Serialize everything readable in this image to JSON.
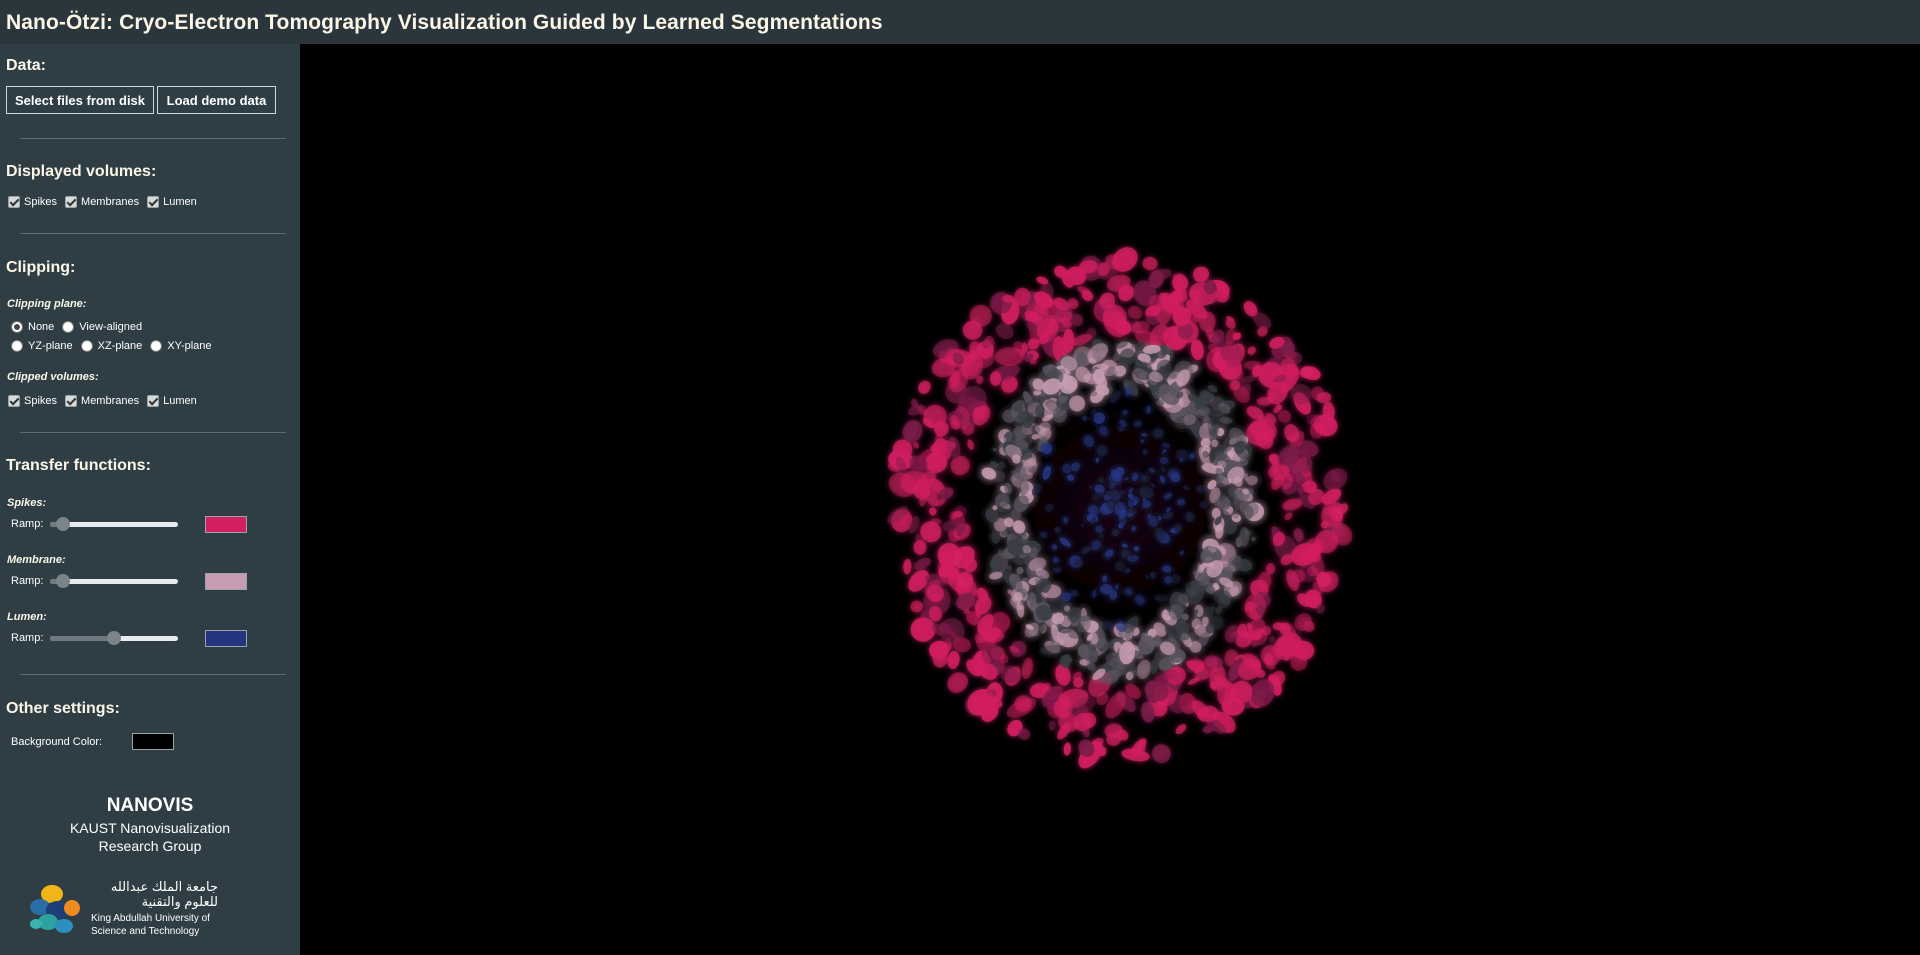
{
  "header": {
    "title": "Nano-Ötzi: Cryo-Electron Tomography Visualization Guided by Learned Segmentations"
  },
  "data_section": {
    "title": "Data:",
    "select_files_label": "Select files from disk",
    "load_demo_label": "Load demo data"
  },
  "displayed_volumes": {
    "title": "Displayed volumes:",
    "items": [
      {
        "label": "Spikes",
        "checked": true
      },
      {
        "label": "Membranes",
        "checked": true
      },
      {
        "label": "Lumen",
        "checked": true
      }
    ]
  },
  "clipping": {
    "title": "Clipping:",
    "plane_title": "Clipping plane:",
    "planes": [
      {
        "label": "None",
        "selected": true
      },
      {
        "label": "View-aligned",
        "selected": false
      },
      {
        "label": "YZ-plane",
        "selected": false
      },
      {
        "label": "XZ-plane",
        "selected": false
      },
      {
        "label": "XY-plane",
        "selected": false
      }
    ],
    "clipped_title": "Clipped volumes:",
    "clipped": [
      {
        "label": "Spikes",
        "checked": true
      },
      {
        "label": "Membranes",
        "checked": true
      },
      {
        "label": "Lumen",
        "checked": true
      }
    ]
  },
  "transfer_functions": {
    "title": "Transfer functions:",
    "items": [
      {
        "name": "Spikes:",
        "ramp_label": "Ramp:",
        "ramp_value": 0.1,
        "color": "#d21f60"
      },
      {
        "name": "Membrane:",
        "ramp_label": "Ramp:",
        "ramp_value": 0.1,
        "color": "#c79cb2"
      },
      {
        "name": "Lumen:",
        "ramp_label": "Ramp:",
        "ramp_value": 0.5,
        "color": "#243580"
      }
    ]
  },
  "other_settings": {
    "title": "Other settings:",
    "bg_label": "Background Color:",
    "bg_color": "#000000"
  },
  "footer": {
    "group_name": "NANOVIS",
    "group_desc_line1": "KAUST Nanovisualization",
    "group_desc_line2": "Research Group",
    "kaust_ar_line1": "جامعة الملك عبدالله",
    "kaust_ar_line2": "للعلوم والتقنية",
    "kaust_en_line1": "King Abdullah University of",
    "kaust_en_line2": "Science and Technology"
  },
  "colors": {
    "header_bg": "#2b363c",
    "sidebar_bg": "#2f3e45",
    "title_text": "#fbf6e6",
    "spikes": "#d21f60",
    "membrane": "#c79cb2",
    "lumen": "#243580"
  }
}
